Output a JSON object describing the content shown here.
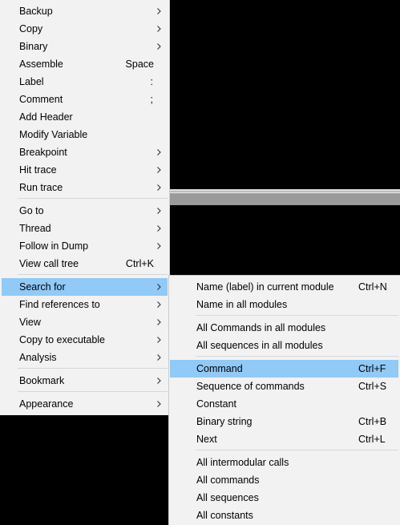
{
  "main_menu": {
    "items": [
      {
        "label": "Backup",
        "submenu": true
      },
      {
        "label": "Copy",
        "submenu": true
      },
      {
        "label": "Binary",
        "submenu": true
      },
      {
        "label": "Assemble",
        "shortcut": "Space"
      },
      {
        "label": "Label",
        "shortcut": ":"
      },
      {
        "label": "Comment",
        "shortcut": ";"
      },
      {
        "label": "Add Header"
      },
      {
        "label": "Modify Variable"
      },
      {
        "label": "Breakpoint",
        "submenu": true
      },
      {
        "label": "Hit trace",
        "submenu": true
      },
      {
        "label": "Run trace",
        "submenu": true
      },
      {
        "label": "Go to",
        "submenu": true
      },
      {
        "label": "Thread",
        "submenu": true
      },
      {
        "label": "Follow in Dump",
        "submenu": true
      },
      {
        "label": "View call tree",
        "shortcut": "Ctrl+K"
      },
      {
        "label": "Search for",
        "submenu": true,
        "highlighted": true
      },
      {
        "label": "Find references to",
        "submenu": true
      },
      {
        "label": "View",
        "submenu": true
      },
      {
        "label": "Copy to executable",
        "submenu": true
      },
      {
        "label": "Analysis",
        "submenu": true
      },
      {
        "label": "Bookmark",
        "submenu": true
      },
      {
        "label": "Appearance",
        "submenu": true
      }
    ]
  },
  "search_submenu": {
    "items": [
      {
        "label": "Name (label) in current module",
        "shortcut": "Ctrl+N"
      },
      {
        "label": "Name in all modules"
      },
      {
        "label": "All Commands in all modules"
      },
      {
        "label": "All sequences in all modules"
      },
      {
        "label": "Command",
        "shortcut": "Ctrl+F",
        "highlighted": true
      },
      {
        "label": "Sequence of commands",
        "shortcut": "Ctrl+S"
      },
      {
        "label": "Constant"
      },
      {
        "label": "Binary string",
        "shortcut": "Ctrl+B"
      },
      {
        "label": "Next",
        "shortcut": "Ctrl+L"
      },
      {
        "label": "All intermodular calls"
      },
      {
        "label": "All commands"
      },
      {
        "label": "All sequences"
      },
      {
        "label": "All constants"
      }
    ]
  },
  "colors": {
    "menu_background": "#f2f2f2",
    "highlight": "#91c9f7",
    "separator": "#d7d7d7",
    "backdrop": "#000000"
  },
  "icons": {
    "submenu_arrow": "chevron-right-icon"
  }
}
